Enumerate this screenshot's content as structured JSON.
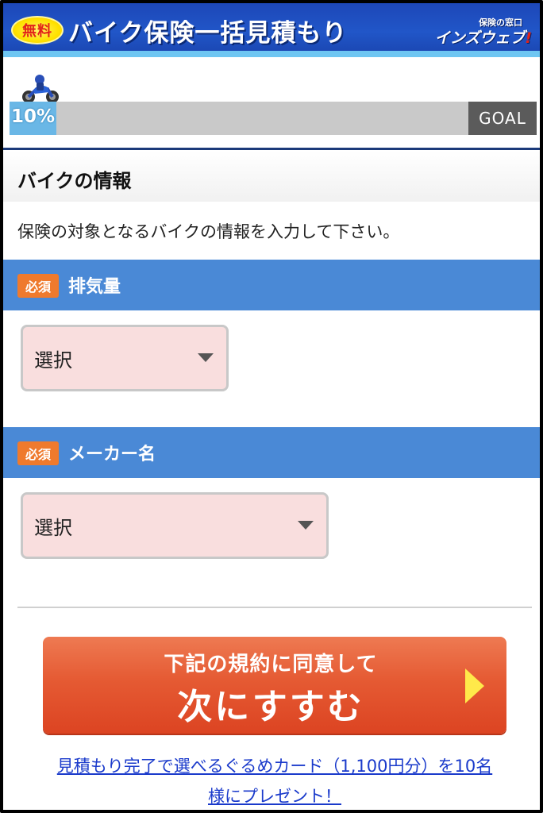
{
  "header": {
    "free_badge": "無料",
    "title": "バイク保険一括見積もり",
    "logo_sub": "保険の窓口",
    "logo_main": "インズウェブ",
    "logo_mark": "!"
  },
  "progress": {
    "percent_label": "10%",
    "value": 0.1,
    "goal_label": "GOAL",
    "icon": "motorcycle-icon"
  },
  "section": {
    "title": "バイクの情報",
    "description": "保険の対象となるバイクの情報を入力して下さい。"
  },
  "fields": [
    {
      "required_badge": "必須",
      "label": "排気量",
      "select_value": "選択"
    },
    {
      "required_badge": "必須",
      "label": "メーカー名",
      "select_value": "選択"
    }
  ],
  "cta": {
    "line1": "下記の規約に同意して",
    "line2": "次にすすむ"
  },
  "promo": {
    "line1": "見積もり完了で選べるぐるめカード（1,100円分）を10名",
    "line2": "様にプレゼント！"
  },
  "colors": {
    "header_blue": "#2156c8",
    "field_bar_blue": "#4a89d6",
    "required_orange": "#ef7a2d",
    "cta_orange": "#e55a33",
    "select_pink": "#f9dede",
    "link_blue": "#1a3acb"
  }
}
